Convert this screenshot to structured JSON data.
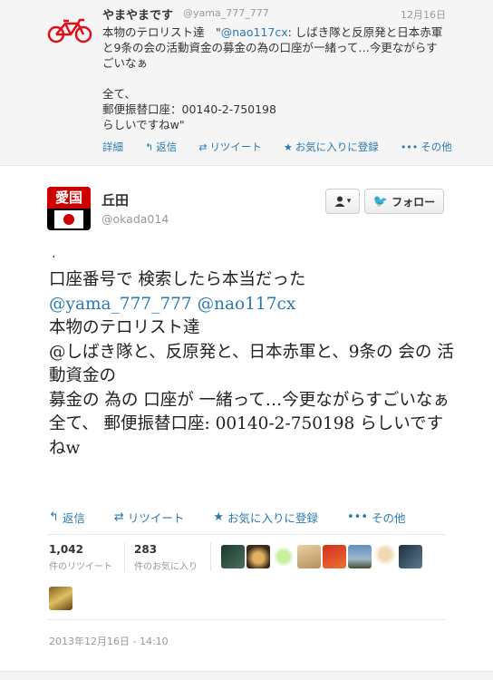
{
  "parent_tweet": {
    "name": "やまやまです",
    "handle": "@yama_777_777",
    "time": "12月16日",
    "text_before_mention": "本物のテロリスト達　\"",
    "mention": "@nao117cx",
    "text_after_mention": ": しばき隊と反原発と日本赤軍と9条の会の活動資金の募金の為の口座が一緒って…今更ながらすごいなぁ\n\n全て、\n郵便振替口座：00140-2-750198\nらしいですねw\"",
    "actions": {
      "details": "詳細",
      "reply": "返信",
      "retweet": "リツイート",
      "favorite": "お気に入りに登録",
      "more": "その他"
    }
  },
  "tweet": {
    "name": "丘田",
    "handle": "@okada014",
    "avatar_text": "愛国",
    "user_menu_label": "▾",
    "follow_label": "フォロー",
    "dot": ".",
    "line1": "口座番号で 検索したら本当だった",
    "mention1": "@yama_777_777",
    "mention2": "@nao117cx",
    "body": "本物のテロリスト達\n@しばき隊と、反原発と、日本赤軍と、9条の 会の 活動資金の\n募金の 為の 口座が 一緒って…今更ながらすごいなぁ\n全て、 郵便振替口座: 00140-2-750198 らしいですねw",
    "actions": {
      "reply": "返信",
      "retweet": "リツイート",
      "favorite": "お気に入りに登録",
      "more": "その他"
    },
    "stats": {
      "retweets": "1,042",
      "retweets_label": "件のリツイート",
      "favorites": "283",
      "favorites_label": "件のお気に入り"
    },
    "date": "2013年12月16日 - 14:10"
  },
  "colors": {
    "link": "#2a7ab0",
    "muted": "#999999",
    "bird": "#2aa3ef",
    "avatar_red": "#cc0000"
  }
}
